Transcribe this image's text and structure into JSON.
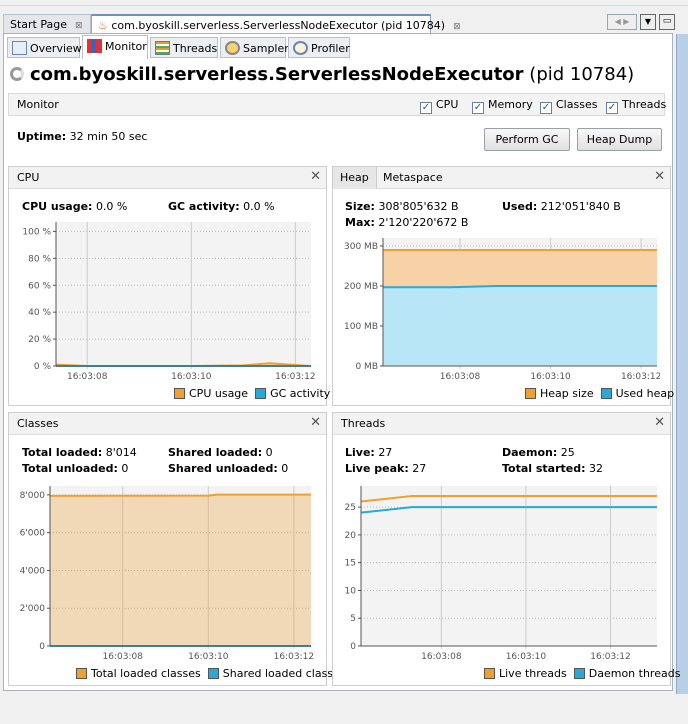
{
  "window_tabs": [
    {
      "label": "Start Page",
      "close": "⊠"
    },
    {
      "label": "com.byoskill.serverless.ServerlessNodeExecutor (pid 10784)",
      "close": "⊠",
      "icon": "java-cup-icon"
    }
  ],
  "sub_tabs": [
    {
      "label": "Overview",
      "icon": "overview-icon"
    },
    {
      "label": "Monitor",
      "icon": "monitor-icon"
    },
    {
      "label": "Threads",
      "icon": "threads-icon"
    },
    {
      "label": "Sampler",
      "icon": "sampler-icon"
    },
    {
      "label": "Profiler",
      "icon": "profiler-icon"
    }
  ],
  "title": {
    "name": "com.byoskill.serverless.ServerlessNodeExecutor",
    "pid": "(pid 10784)"
  },
  "monitor_bar": {
    "label": "Monitor",
    "checkboxes": [
      {
        "label": "CPU",
        "checked": true
      },
      {
        "label": "Memory",
        "checked": true
      },
      {
        "label": "Classes",
        "checked": true
      },
      {
        "label": "Threads",
        "checked": true
      }
    ]
  },
  "uptime": {
    "label": "Uptime:",
    "value": "32 min 50 sec"
  },
  "buttons": {
    "gc": "Perform GC",
    "heap_dump": "Heap Dump"
  },
  "panels": {
    "cpu": {
      "title": "CPU",
      "stats": [
        {
          "label": "CPU usage:",
          "value": "0.0 %"
        },
        {
          "label": "GC activity:",
          "value": "0.0 %"
        }
      ]
    },
    "heap": {
      "tabs": [
        "Heap",
        "Metaspace"
      ],
      "stats": [
        {
          "label": "Size:",
          "value": "308'805'632 B"
        },
        {
          "label": "Used:",
          "value": "212'051'840 B"
        },
        {
          "label": "Max:",
          "value": "2'120'220'672 B"
        }
      ]
    },
    "classes": {
      "title": "Classes",
      "stats": [
        {
          "label": "Total loaded:",
          "value": "8'014"
        },
        {
          "label": "Shared loaded:",
          "value": "0"
        },
        {
          "label": "Total unloaded:",
          "value": "0"
        },
        {
          "label": "Shared unloaded:",
          "value": "0"
        }
      ]
    },
    "threads": {
      "title": "Threads",
      "stats": [
        {
          "label": "Live:",
          "value": "27"
        },
        {
          "label": "Daemon:",
          "value": "25"
        },
        {
          "label": "Live peak:",
          "value": "27"
        },
        {
          "label": "Total started:",
          "value": "32"
        }
      ]
    }
  },
  "chart_data": [
    {
      "id": "cpu",
      "type": "area",
      "x_ticks": [
        "16:03:08",
        "16:03:10",
        "16:03:12"
      ],
      "xlim": [
        "16:03:07.4",
        "16:03:12.3"
      ],
      "ylim": [
        0,
        107
      ],
      "y_ticks": [
        0,
        20,
        40,
        60,
        80,
        100
      ],
      "y_tick_labels": [
        "0 %",
        "20 %",
        "40 %",
        "60 %",
        "80 %",
        "100 %"
      ],
      "grid": true,
      "legend": "bottom-right",
      "series": [
        {
          "name": "CPU usage",
          "color": "#f0a030",
          "x": [
            "16:03:07.4",
            "16:03:08",
            "16:03:10",
            "16:03:11",
            "16:03:11.5",
            "16:03:12.3"
          ],
          "y": [
            1,
            0,
            0,
            0.5,
            2,
            0
          ]
        },
        {
          "name": "GC activity",
          "color": "#2aa8d8",
          "x": [
            "16:03:07.4",
            "16:03:12.3"
          ],
          "y": [
            0,
            0
          ]
        }
      ]
    },
    {
      "id": "heap",
      "type": "area",
      "x_ticks": [
        "16:03:08",
        "16:03:10",
        "16:03:12"
      ],
      "xlim": [
        "16:03:06.3",
        "16:03:12.35"
      ],
      "ylim": [
        0,
        320
      ],
      "y_ticks": [
        0,
        100,
        200,
        300
      ],
      "y_tick_labels": [
        "0 MB",
        "100 MB",
        "200 MB",
        "300 MB"
      ],
      "grid": true,
      "legend": "bottom-right",
      "series": [
        {
          "name": "Heap size",
          "color": "#f0a030",
          "fill": "#f6d2a6",
          "x": [
            "16:03:06.3",
            "16:03:12.35"
          ],
          "y": [
            290,
            290
          ]
        },
        {
          "name": "Used heap",
          "color": "#2aa8d8",
          "fill": "#b8e6f6",
          "x": [
            "16:03:06.3",
            "16:03:07.8",
            "16:03:08.8",
            "16:03:12.35"
          ],
          "y": [
            197,
            197,
            200,
            200
          ]
        }
      ]
    },
    {
      "id": "classes",
      "type": "area",
      "x_ticks": [
        "16:03:08",
        "16:03:10",
        "16:03:12"
      ],
      "xlim": [
        "16:03:06.3",
        "16:03:12.4"
      ],
      "ylim": [
        0,
        8470
      ],
      "y_ticks": [
        0,
        2000,
        4000,
        6000,
        8000
      ],
      "y_tick_labels": [
        "0",
        "2'000",
        "4'000",
        "6'000",
        "8'000"
      ],
      "grid": true,
      "legend": "bottom-right",
      "series": [
        {
          "name": "Total loaded classes",
          "color": "#f0a030",
          "x": [
            "16:03:06.3",
            "16:03:10",
            "16:03:10.2",
            "16:03:12.4"
          ],
          "y": [
            7950,
            7960,
            8014,
            8014
          ]
        },
        {
          "name": "Shared loaded classes",
          "color": "#2aa8d8",
          "x": [
            "16:03:06.3",
            "16:03:12.4"
          ],
          "y": [
            0,
            0
          ]
        }
      ]
    },
    {
      "id": "threads",
      "type": "line",
      "x_ticks": [
        "16:03:08",
        "16:03:10",
        "16:03:12"
      ],
      "xlim": [
        "16:03:06.1",
        "16:03:13.1"
      ],
      "ylim": [
        0,
        28.8
      ],
      "y_ticks": [
        0,
        5,
        10,
        15,
        20,
        25
      ],
      "y_tick_labels": [
        "0",
        "5",
        "10",
        "15",
        "20",
        "25"
      ],
      "grid": true,
      "legend": "bottom-right",
      "series": [
        {
          "name": "Live threads",
          "color": "#f0a030",
          "x": [
            "16:03:06.1",
            "16:03:07.3",
            "16:03:13.1"
          ],
          "y": [
            26,
            27,
            27
          ]
        },
        {
          "name": "Daemon threads",
          "color": "#2aa8d8",
          "x": [
            "16:03:06.1",
            "16:03:07.3",
            "16:03:13.1"
          ],
          "y": [
            24,
            25,
            25
          ]
        }
      ]
    }
  ]
}
